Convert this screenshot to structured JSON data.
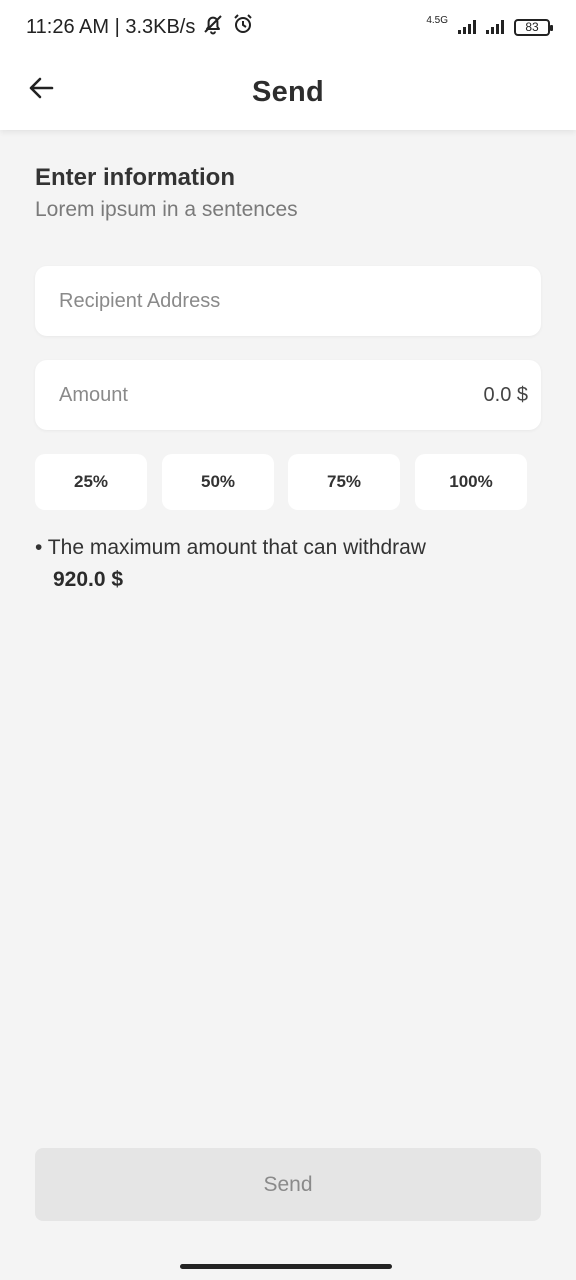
{
  "status_bar": {
    "time_speed": "11:26 AM | 3.3KB/s",
    "network_label": "4.5G",
    "battery": "83",
    "icons": [
      "bell-off-icon",
      "alarm-icon",
      "signal-icon",
      "battery-icon"
    ]
  },
  "header": {
    "title": "Send",
    "back_icon": "arrow-left-icon"
  },
  "info": {
    "title": "Enter information",
    "subtitle": "Lorem ipsum in a sentences"
  },
  "form": {
    "recipient_placeholder": "Recipient Address",
    "amount_placeholder": "Amount",
    "amount_value": "0.0 $"
  },
  "percentages": [
    "25%",
    "50%",
    "75%",
    "100%"
  ],
  "note": {
    "text": "• The maximum amount that can withdraw",
    "amount": "920.0 $"
  },
  "actions": {
    "send_label": "Send"
  },
  "colors": {
    "background": "#f4f4f4",
    "surface": "#ffffff",
    "disabled_button": "#e5e5e5",
    "text_primary": "#333333",
    "text_muted": "#8a8a8a"
  }
}
